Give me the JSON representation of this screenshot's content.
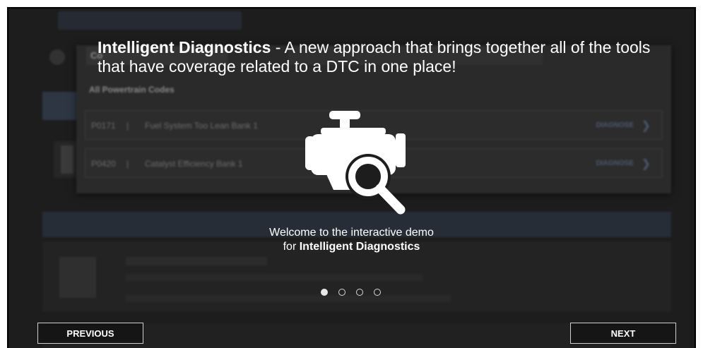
{
  "overlay": {
    "headline_bold": "Intelligent Diagnostics",
    "headline_rest": " - A new approach that brings together all of the tools that have coverage related to a DTC in one place!",
    "logo_icon": "engine-magnifier-icon",
    "welcome_line1": "Welcome to the interactive demo",
    "welcome_prefix": "for ",
    "welcome_bold": "Intelligent Diagnostics",
    "steps": 4,
    "active_step": 1
  },
  "background": {
    "panel_header": "Co",
    "section_title": "All Powertrain Codes",
    "codes": [
      {
        "code": "P0171",
        "separator": "|",
        "description": "Fuel System Too Lean Bank 1",
        "action": "DIAGNOSE"
      },
      {
        "code": "P0420",
        "separator": "|",
        "description": "Catalyst Efficiency Bank 1",
        "action": "DIAGNOSE"
      }
    ]
  },
  "navigation": {
    "previous_label": "PREVIOUS",
    "next_label": "NEXT"
  }
}
